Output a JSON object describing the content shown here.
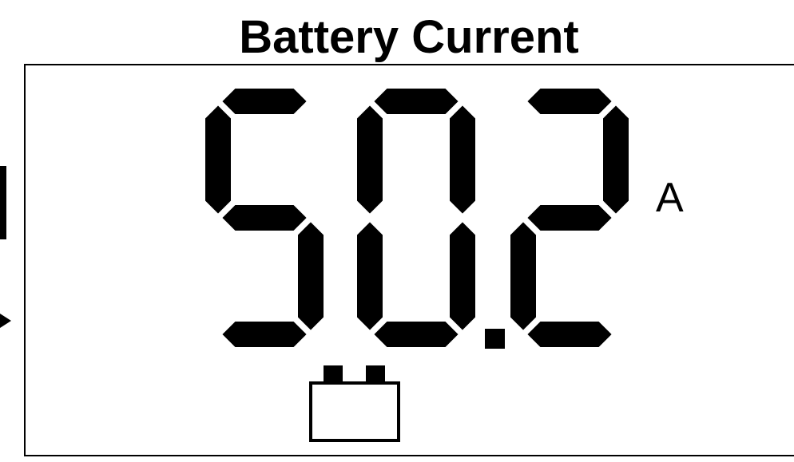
{
  "title": "Battery Current",
  "display": {
    "reading": "50.2",
    "digits": [
      "5",
      "0",
      "2"
    ],
    "decimal_after_digit": 2,
    "unit": "A"
  },
  "icons": {
    "battery": "battery-icon",
    "side_arrow": "arrow-right-icon"
  },
  "colors": {
    "segment": "#000000",
    "background": "#ffffff"
  }
}
